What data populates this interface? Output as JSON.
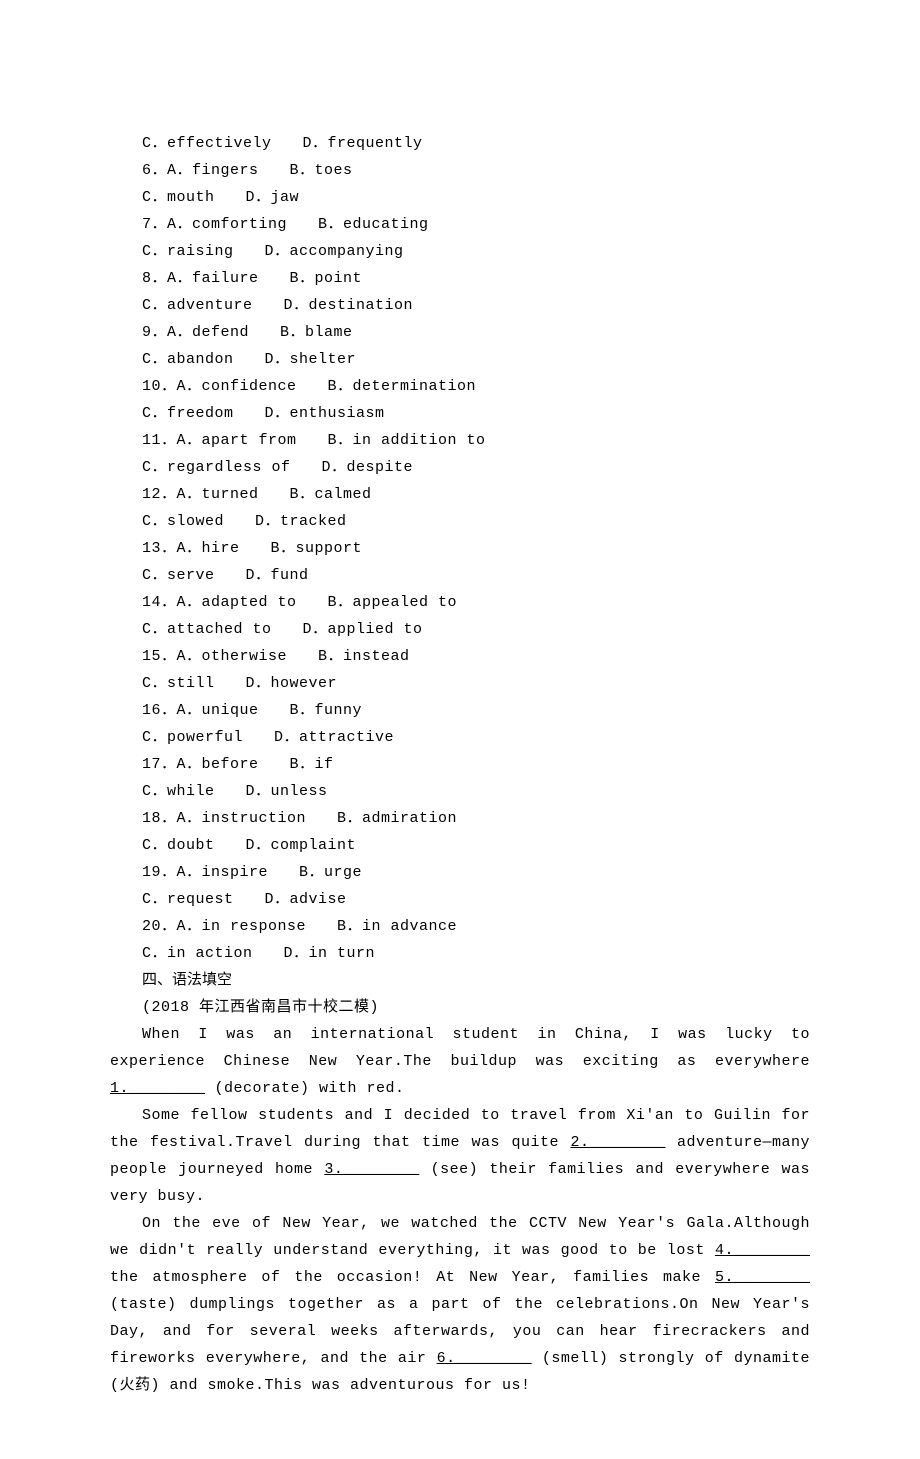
{
  "questions": [
    {
      "num": "",
      "row1": "C．effectively　　D．frequently"
    },
    {
      "num": "6",
      "row1": "A．fingers　　B．toes",
      "row2": "C．mouth　　D．jaw"
    },
    {
      "num": "7",
      "row1": "A．comforting　　B．educating",
      "row2": "C．raising　　D．accompanying"
    },
    {
      "num": "8",
      "row1": "A．failure　　B．point",
      "row2": "C．adventure　　D．destination"
    },
    {
      "num": "9",
      "row1": "A．defend　　B．blame",
      "row2": "C．abandon　　D．shelter"
    },
    {
      "num": "10",
      "row1": "A．confidence　　B．determination",
      "row2": "C．freedom　　D．enthusiasm"
    },
    {
      "num": "11",
      "row1": "A．apart from　　B．in addition to",
      "row2": "C．regardless of　　D．despite"
    },
    {
      "num": "12",
      "row1": "A．turned　　B．calmed",
      "row2": "C．slowed　　D．tracked"
    },
    {
      "num": "13",
      "row1": "A．hire　　B．support",
      "row2": "C．serve　　D．fund"
    },
    {
      "num": "14",
      "row1": "A．adapted to　　B．appealed to",
      "row2": "C．attached to　　D．applied to"
    },
    {
      "num": "15",
      "row1": "A．otherwise　　B．instead",
      "row2": "C．still　　D．however"
    },
    {
      "num": "16",
      "row1": "A．unique　　B．funny",
      "row2": "C．powerful　　D．attractive"
    },
    {
      "num": "17",
      "row1": "A．before　　B．if",
      "row2": "C．while　　D．unless"
    },
    {
      "num": "18",
      "row1": "A．instruction　　B．admiration",
      "row2": "C．doubt　　D．complaint"
    },
    {
      "num": "19",
      "row1": "A．inspire　　B．urge",
      "row2": "C．request　　D．advise"
    },
    {
      "num": "20",
      "row1": "A．in response　　B．in advance",
      "row2": "C．in action　　D．in turn"
    }
  ],
  "section_heading": "四、语法填空",
  "source_line": "(2018 年江西省南昌市十校二模)",
  "passage": {
    "p1a": "When I was an international student in China, I was lucky to experience Chinese New Year.The build­up was exciting as everywhere ",
    "b1_label": "1.",
    "b1_blank": "________",
    "p1b": " (decorate) with red.",
    "p2a": "Some fellow students and I decided to travel from Xi'an to Guilin for the festival.Travel during that time was quite ",
    "b2_label": "2.",
    "b2_blank": "________",
    "p2b": " adventure—many people journeyed home ",
    "b3_label": "3.",
    "b3_blank": "________",
    "p2c": " (see) their families and everywhere was very busy.",
    "p3a": "On the eve of New Year, we watched the CCTV New Year's Gala.Although we didn't really understand everything, it was good to be lost ",
    "b4_label": "4.",
    "b4_blank": "________",
    "p3b": " the atmosphere of the occasion! At New Year, families make ",
    "b5_label": "5.",
    "b5_blank": "________",
    "p3c": " (taste) dumplings together as a part of the celebrations.On New Year's Day, and for several weeks afterwards, you can hear firecrackers and fireworks everywhere, and the air ",
    "b6_label": "6.",
    "b6_blank": "________",
    "p3d": " (smell) strongly of dynamite (火药) and smoke.This was adventurous for us!"
  }
}
